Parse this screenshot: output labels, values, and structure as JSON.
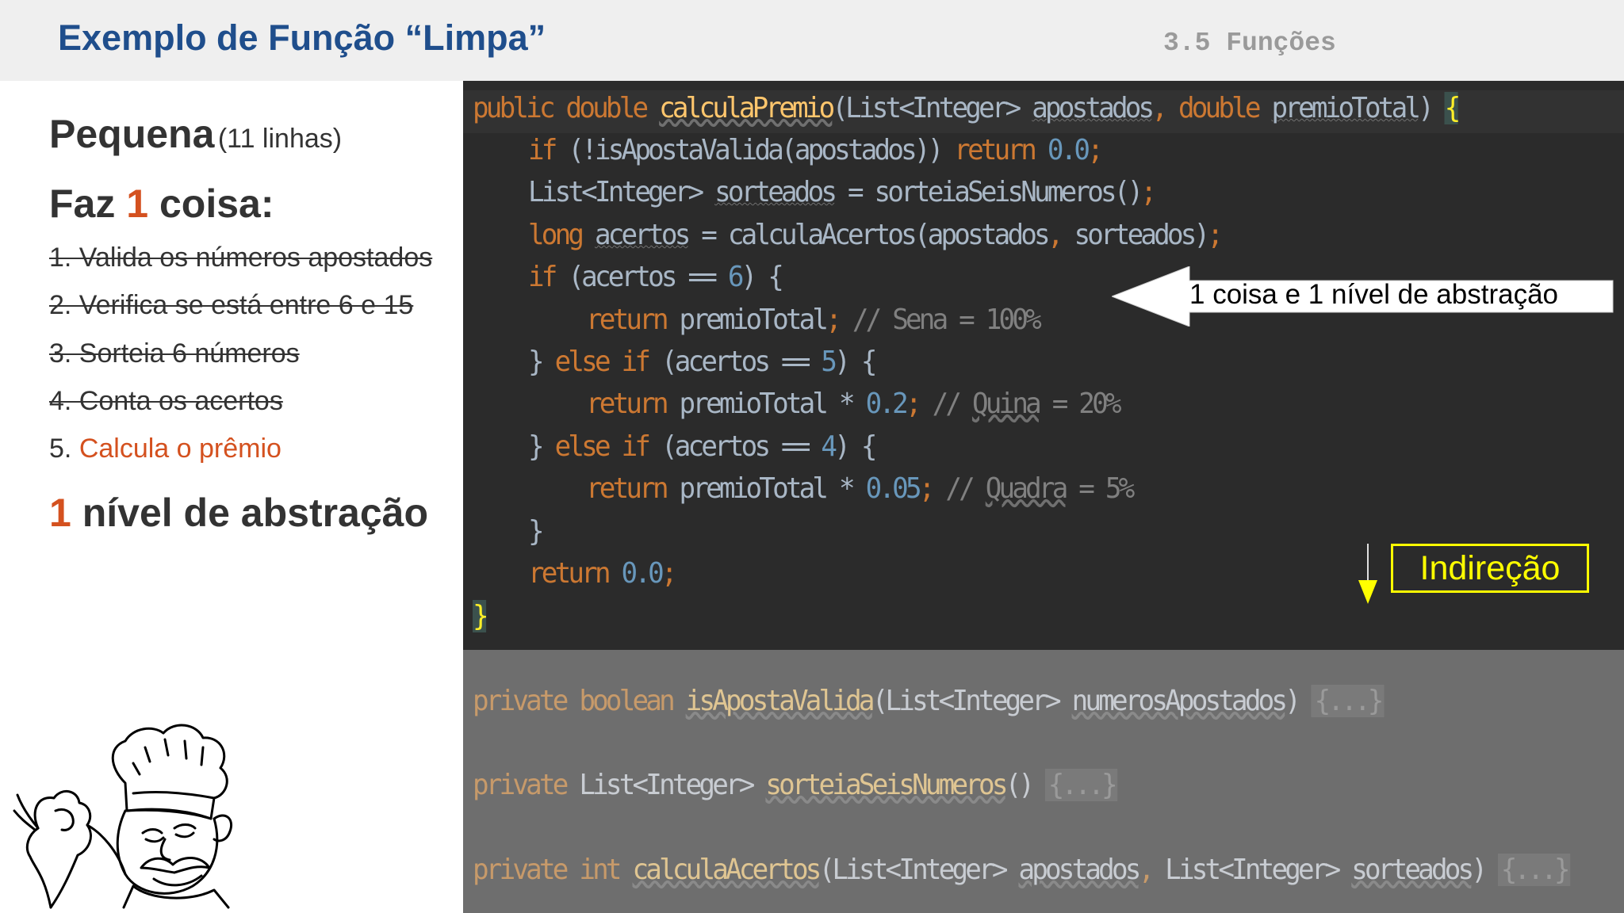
{
  "header": {
    "title": "Exemplo de Função “Limpa”",
    "section": "3.5 Funções"
  },
  "left_panel": {
    "pequena_label": "Pequena",
    "pequena_detail": "(11 linhas)",
    "faz_prefix": "Faz",
    "faz_number": "1",
    "faz_suffix": "coisa:",
    "items": [
      {
        "text": "1. Valida os números apostados",
        "struck": true
      },
      {
        "text": "2. Verifica se está entre 6 e 15",
        "struck": true
      },
      {
        "text": "3. Sorteia 6 números",
        "struck": true
      },
      {
        "text": "4. Conta os acertos",
        "struck": true
      }
    ],
    "item5_number": "5.",
    "item5_text": "Calcula o prêmio",
    "nivel_number": "1",
    "nivel_text": "nível de abstração"
  },
  "annotations": {
    "callout_text": "1 coisa e 1 nível de abstração",
    "indirecao_label": "Indireção"
  },
  "code": {
    "l1": {
      "public": "public",
      "double": "double",
      "name": "calculaPremio",
      "open": "(List<Integer> ",
      "p1": "apostados",
      "comma": ", ",
      "double2": "double",
      "sp": " ",
      "p2": "premioTotal",
      "close": ") ",
      "brace": "{"
    },
    "l2": {
      "if": "if",
      "expr": " (!isApostaValida(apostados)) ",
      "return": "return",
      "sp": " ",
      "num": "0.0",
      "semi": ";"
    },
    "l3": {
      "type": "List<Integer> ",
      "var": "sorteados",
      "rest": " = sorteiaSeisNumeros()",
      "semi": ";"
    },
    "l4": {
      "long": "long",
      "sp": " ",
      "var": "acertos",
      "rest": " = calculaAcertos(apostados",
      "comma": ",",
      "rest2": " sorteados)",
      "semi": ";"
    },
    "l5": {
      "if": "if",
      "open": " (acertos == ",
      "num": "6",
      "close": ") {"
    },
    "l6": {
      "return": "return",
      "rest": " premioTotal",
      "semi": ";",
      "comment": " // Sena = 100%"
    },
    "l7": {
      "open": "} ",
      "else": "else",
      "sp": " ",
      "if": "if",
      "cond": " (acertos == ",
      "num": "5",
      "close": ") {"
    },
    "l8": {
      "return": "return",
      "rest": " premioTotal * ",
      "num": "0.2",
      "semi": ";",
      "cm1": " // ",
      "word": "Quina",
      "cm2": " = 20%"
    },
    "l9": {
      "open": "} ",
      "else": "else",
      "sp": " ",
      "if": "if",
      "cond": " (acertos == ",
      "num": "4",
      "close": ") {"
    },
    "l10": {
      "return": "return",
      "rest": " premioTotal * ",
      "num": "0.05",
      "semi": ";",
      "cm1": " // ",
      "word": "Quadra",
      "cm2": " = 5%"
    },
    "l11": {
      "brace": "}"
    },
    "l12": {
      "return": "return",
      "sp": " ",
      "num": "0.0",
      "semi": ";"
    },
    "l13": {
      "brace": "}"
    }
  },
  "collapsed_methods": {
    "m1": {
      "private": "private",
      "type": " boolean ",
      "name": "isApostaValida",
      "open": "(List<Integer> ",
      "param": "numerosApostados",
      "close": ") ",
      "fold": "{...}"
    },
    "m2": {
      "private": "private",
      "type": " List<Integer> ",
      "name": "sorteiaSeisNumeros",
      "close": "() ",
      "fold": "{...}"
    },
    "m3": {
      "private": "private",
      "int": "int",
      "sp": " ",
      "name": "calculaAcertos",
      "open": "(List<Integer> ",
      "p1": "apostados",
      "comma": ",",
      "type2": " List<Integer> ",
      "p2": "sorteados",
      "close": ") ",
      "fold": "{...}"
    }
  },
  "colors": {
    "title_blue": "#1f4e8c",
    "accent_orange": "#d4511f",
    "editor_bg": "#2b2b2b",
    "keyword": "#cc7832",
    "method": "#ffc66d",
    "number": "#6897bb",
    "indirecao_yellow": "#ffff00"
  }
}
